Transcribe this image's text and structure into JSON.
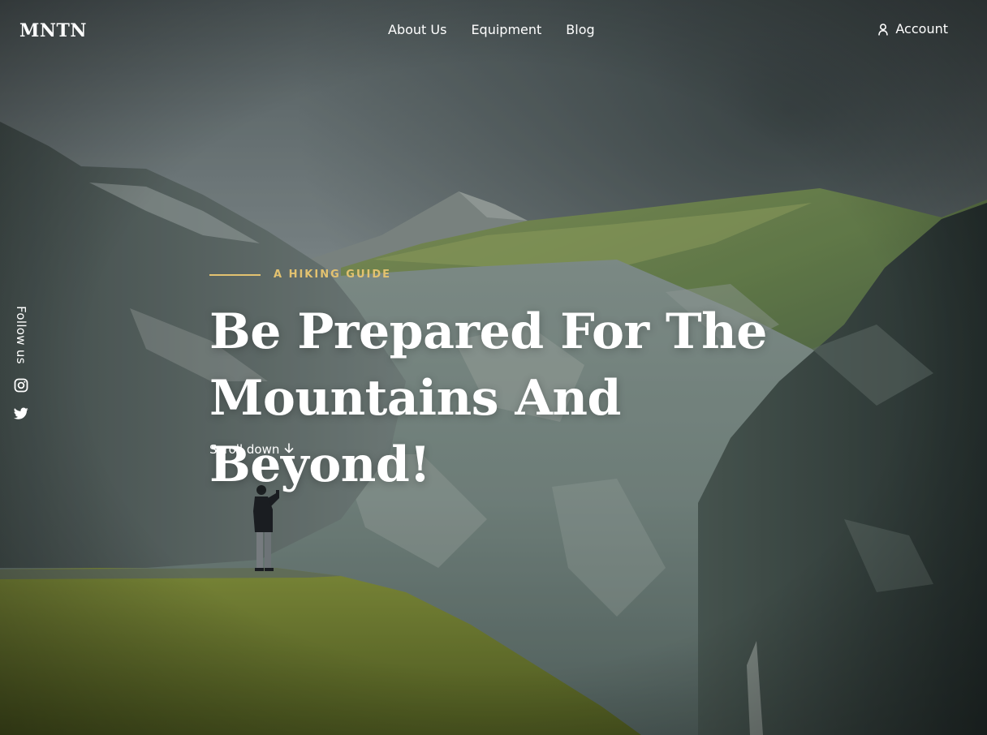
{
  "header": {
    "logo": "MNTN",
    "nav": [
      "About Us",
      "Equipment",
      "Blog"
    ],
    "account_label": "Account"
  },
  "social": {
    "follow_label": "Follow us",
    "icons": [
      "instagram-icon",
      "twitter-icon"
    ]
  },
  "hero": {
    "eyebrow": "A HIKING GUIDE",
    "headline_line1": "Be Prepared For The",
    "headline_line2": "Mountains And Beyond!",
    "scroll_label": "Scroll down"
  },
  "colors": {
    "accent": "#e3c270",
    "text": "#ffffff"
  }
}
